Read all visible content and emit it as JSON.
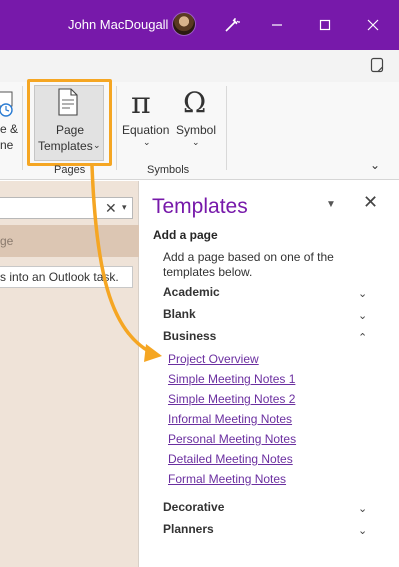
{
  "titlebar": {
    "user_name": "John MacDougall",
    "bg_color": "#7719aa",
    "icons": [
      "avatar",
      "magic-wand-icon",
      "minimize-icon",
      "maximize-icon",
      "close-icon"
    ]
  },
  "ribbon": {
    "left_partial_label_1": "e &",
    "left_partial_label_2": "ne",
    "page_templates_line1": "Page",
    "page_templates_line2": "Templates",
    "equation_label": "Equation",
    "symbol_label": "Symbol",
    "pages_group_label": "Pages",
    "symbols_group_label": "Symbols",
    "highlight_color": "#f5a623"
  },
  "left_pane": {
    "page_row_text": "ge",
    "task_tip_text": "s into an Outlook task."
  },
  "templates_pane": {
    "title": "Templates",
    "add_page_heading": "Add a page",
    "add_page_desc": "Add a page based on one of the templates below.",
    "categories_top": [
      {
        "label": "Academic",
        "expanded": false
      },
      {
        "label": "Blank",
        "expanded": false
      },
      {
        "label": "Business",
        "expanded": true
      }
    ],
    "business_templates": [
      "Project Overview",
      "Simple Meeting Notes 1",
      "Simple Meeting Notes 2",
      "Informal Meeting Notes",
      "Personal Meeting Notes",
      "Detailed Meeting Notes",
      "Formal Meeting Notes"
    ],
    "categories_bottom": [
      {
        "label": "Decorative",
        "expanded": false
      },
      {
        "label": "Planners",
        "expanded": false
      }
    ],
    "accent_color": "#7719aa",
    "link_color": "#6b2fa0"
  }
}
